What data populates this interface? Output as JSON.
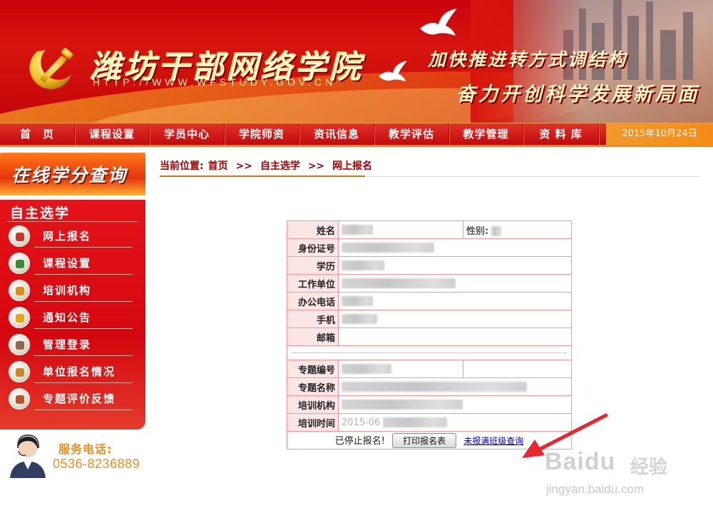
{
  "header": {
    "site_title": "潍坊干部网络学院",
    "site_url": "HTTP://WWW.WFSTUDY.GOV.CN",
    "slogan_1": "加快推进转方式调结构",
    "slogan_2": "奋力开创科学发展新局面"
  },
  "nav": {
    "items": [
      "首　页",
      "课程设置",
      "学员中心",
      "学院师资",
      "资讯信息",
      "教学评估",
      "教学管理",
      "资 料 库"
    ],
    "date": "2015年10月24日"
  },
  "sidebar": {
    "credit_banner": "在线学分查询",
    "menu_title": "自主选学",
    "items": [
      {
        "label": "网上报名",
        "icon": "hand-icon"
      },
      {
        "label": "课程设置",
        "icon": "book-icon"
      },
      {
        "label": "培训机构",
        "icon": "building-icon"
      },
      {
        "label": "通知公告",
        "icon": "megaphone-icon"
      },
      {
        "label": "管理登录",
        "icon": "login-icon"
      },
      {
        "label": "单位报名情况",
        "icon": "folder-icon"
      },
      {
        "label": "专题评价反馈",
        "icon": "feedback-icon"
      }
    ],
    "service_label": "服务电话:",
    "service_phone": "0536-8236889"
  },
  "breadcrumb": {
    "prefix": "当前位置:",
    "items": [
      "首页",
      ">>",
      "自主选学",
      ">>",
      "网上报名"
    ]
  },
  "form": {
    "name_label": "姓名",
    "gender_label": "性别:",
    "id_label": "身份证号",
    "education_label": "学历",
    "workplace_label": "工作单位",
    "office_phone_label": "办公电话",
    "mobile_label": "手机",
    "email_label": "邮箱",
    "topic_no_label": "专题编号",
    "topic_name_label": "专题名称",
    "institution_label": "培训机构",
    "training_time_label": "培训时间",
    "training_time_value": "2015-06"
  },
  "actions": {
    "stopped_text": "已停止报名!",
    "print_button": "打印报名表",
    "class_query_link": "未报满班级查询"
  },
  "watermark": {
    "baidu": "Baidu",
    "jingyan": "经验",
    "url": "jingyan.baidu.com"
  },
  "colors": {
    "banner_red": "#c8040a",
    "nav_accent": "#f08c1e",
    "breadcrumb_red": "#a50000",
    "table_border": "#f19a9a",
    "link_blue": "#0000cc",
    "arrow_red": "#e8262d"
  }
}
